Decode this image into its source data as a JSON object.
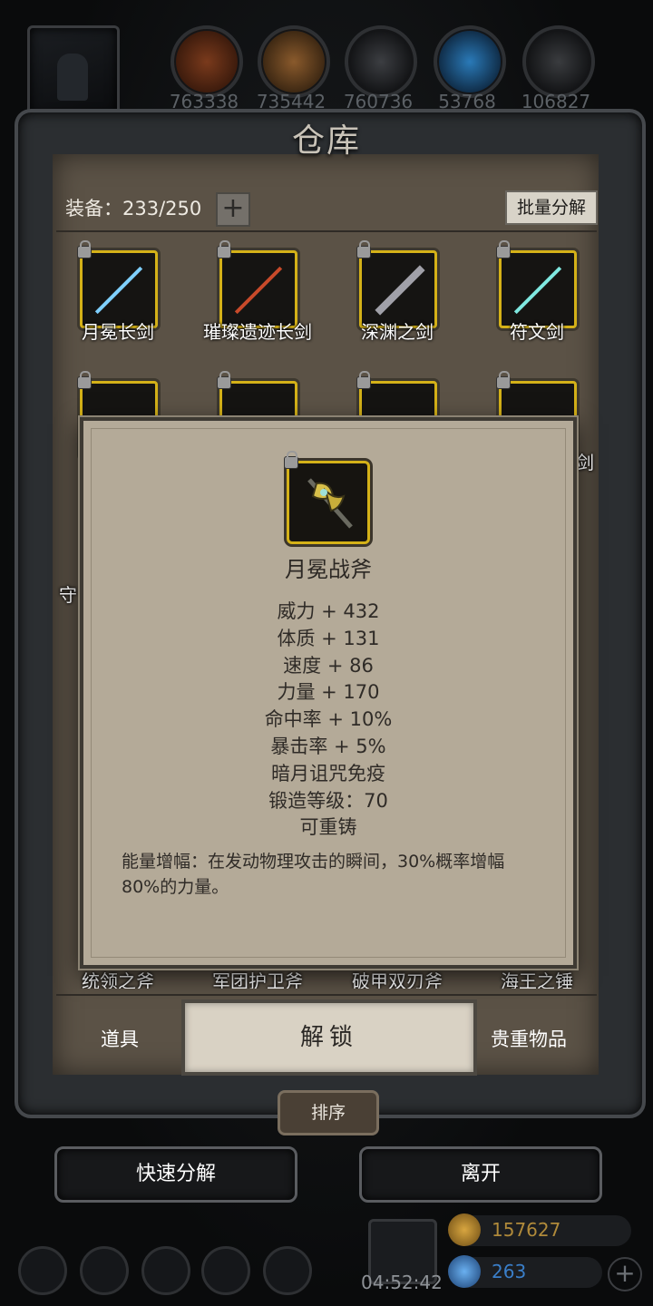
{
  "top_resources": [
    {
      "icon": "leather-icon",
      "value": "763338",
      "color": "#7a3a1c"
    },
    {
      "icon": "wood-icon",
      "value": "735442",
      "color": "#8a5a2c"
    },
    {
      "icon": "iron-icon",
      "value": "760736",
      "color": "#3c3e42"
    },
    {
      "icon": "crystal-icon",
      "value": "53768",
      "color": "#2a7ab8"
    },
    {
      "icon": "ore-icon",
      "value": "106827",
      "color": "#3a3c3f"
    }
  ],
  "title": "仓库",
  "inventory": {
    "equip_label": "装备：233/250",
    "add_label": "+",
    "batch_label": "批量分解"
  },
  "items_row1": [
    {
      "name": "月冕长剑",
      "icon": "sword-icon",
      "color": "#7fd0ff"
    },
    {
      "name": "璀璨遗迹长剑",
      "icon": "longsword-icon",
      "color": "#c84a2a"
    },
    {
      "name": "深渊之剑",
      "icon": "greatsword-icon",
      "color": "#a0a0a8"
    },
    {
      "name": "符文剑",
      "icon": "rune-sword-icon",
      "color": "#7fe8e0"
    }
  ],
  "items_partial": {
    "right_label": "剑",
    "left_label": "守",
    "bottom_row": [
      "统领之斧",
      "军团护卫斧",
      "破甲双刃斧",
      "海王之锤"
    ]
  },
  "popup": {
    "icon": "battle-axe-icon",
    "name": "月冕战斧",
    "stats": [
      "威力 + 432",
      "体质 + 131",
      "速度 + 86",
      "力量 + 170",
      "命中率 + 10%",
      "暴击率 + 5%",
      "暗月诅咒免疫",
      "锻造等级：70",
      "可重铸"
    ],
    "description": "能量增幅：在发动物理攻击的瞬间，30%概率增幅80%的力量。"
  },
  "tabs": {
    "props": "道具",
    "unlock": "解锁",
    "valuables": "贵重物品"
  },
  "sort_label": "排序",
  "buttons": {
    "quick_decompose": "快速分解",
    "leave": "离开"
  },
  "dock": {
    "timer": "04:52:42",
    "gold": "157627",
    "gems": "263",
    "gold_color": "#b08a3a",
    "gem_color": "#3a7ec8"
  }
}
